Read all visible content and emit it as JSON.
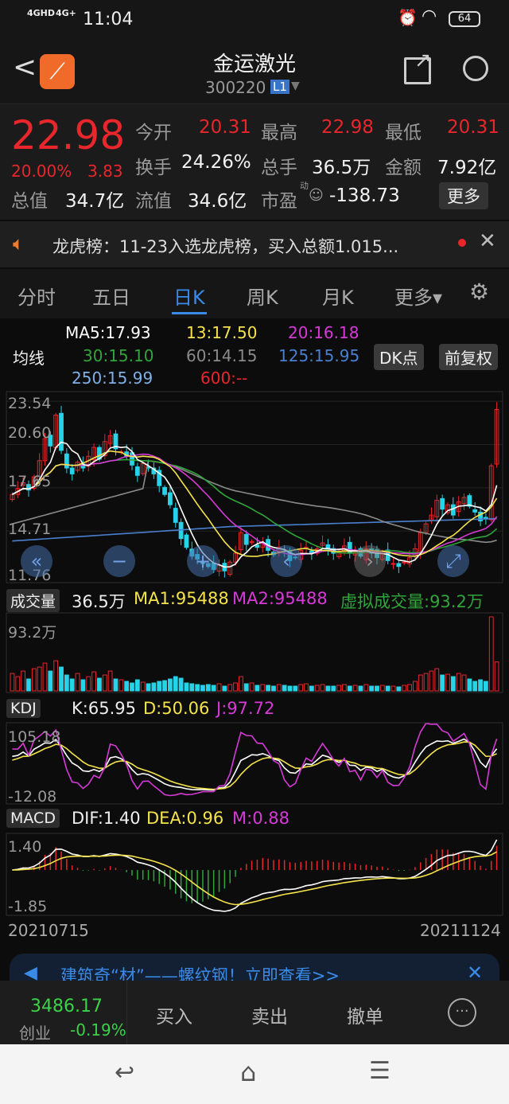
{
  "status": {
    "network1": "4GHD",
    "network2": "4G+",
    "time": "11:04",
    "battery": "64"
  },
  "header": {
    "title": "金运激光",
    "code": "300220",
    "level": "L1"
  },
  "quote": {
    "price": "22.98",
    "change_pct": "20.00%",
    "change": "3.83",
    "open_label": "今开",
    "open": "20.31",
    "high_label": "最高",
    "high": "22.98",
    "low_label": "最低",
    "low": "20.31",
    "turnover_label": "换手",
    "turnover": "24.26%",
    "volume_label": "总手",
    "volume": "36.5万",
    "amount_label": "金额",
    "amount": "7.92亿",
    "mcap_label": "总值",
    "mcap": "34.7亿",
    "float_label": "流值",
    "float": "34.6亿",
    "pe_label": "市盈",
    "pe_sup": "动",
    "pe": "-138.73",
    "more": "更多"
  },
  "notice": {
    "text": "龙虎榜：11-23入选龙虎榜，买入总额1.015..."
  },
  "tabs": [
    {
      "label": "分时"
    },
    {
      "label": "五日"
    },
    {
      "label": "日K"
    },
    {
      "label": "周K"
    },
    {
      "label": "月K"
    },
    {
      "label": "更多▾"
    }
  ],
  "ma_legend": {
    "title": "均线",
    "ma5": "MA5:17.93",
    "ma13": "13:17.50",
    "ma20": "20:16.18",
    "ma30": "30:15.10",
    "ma60": "60:14.15",
    "ma125": "125:15.95",
    "ma250": "250:15.99",
    "ma600": "600:--",
    "dk": "DK点",
    "fq": "前复权"
  },
  "colors": {
    "up": "#e8262b",
    "down": "#27d3e6",
    "ma5": "#ffffff",
    "ma13": "#f4e34a",
    "ma20": "#d63ad6",
    "ma30": "#2fa53a",
    "ma60": "#8a8a8a",
    "ma125": "#4a7fd0",
    "ma250": "#7fb0e6"
  },
  "chart_data": {
    "type": "candlestick",
    "y_ticks": [
      "23.54",
      "20.60",
      "17.65",
      "14.71",
      "11.76"
    ],
    "ylim": [
      11.2,
      24.2
    ],
    "closes": [
      17.2,
      17.6,
      18.0,
      17.5,
      18.4,
      19.5,
      21.0,
      20.5,
      22.6,
      20.2,
      19.0,
      18.6,
      19.4,
      19.0,
      19.8,
      20.4,
      19.6,
      20.8,
      21.2,
      20.3,
      20.1,
      19.8,
      19.2,
      18.5,
      19.3,
      19.0,
      18.6,
      17.8,
      17.2,
      16.5,
      15.3,
      14.2,
      13.6,
      13.0,
      12.8,
      12.5,
      12.3,
      12.1,
      12.4,
      12.0,
      12.6,
      13.2,
      14.6,
      13.8,
      14.0,
      13.6,
      13.9,
      13.4,
      13.1,
      13.6,
      13.3,
      12.7,
      12.9,
      13.4,
      13.6,
      13.2,
      13.5,
      13.9,
      13.4,
      13.2,
      13.3,
      13.7,
      13.2,
      13.4,
      13.0,
      13.5,
      13.2,
      12.9,
      13.3,
      12.7,
      12.5,
      12.3,
      12.6,
      12.9,
      13.5,
      14.6,
      15.2,
      15.8,
      16.8,
      16.2,
      16.5,
      15.8,
      16.7,
      17.0,
      16.4,
      16.0,
      15.4,
      15.6,
      19.15,
      22.98
    ],
    "volumes": [
      22,
      18,
      25,
      15,
      28,
      30,
      35,
      25,
      38,
      30,
      20,
      15,
      22,
      14,
      18,
      24,
      16,
      20,
      25,
      15,
      14,
      12,
      10,
      14,
      11,
      9,
      10,
      12,
      13,
      15,
      18,
      16,
      10,
      9,
      8,
      7,
      8,
      7,
      9,
      6,
      8,
      10,
      18,
      9,
      10,
      7,
      8,
      7,
      6,
      8,
      7,
      6,
      6,
      8,
      9,
      6,
      7,
      8,
      6,
      6,
      7,
      8,
      6,
      7,
      6,
      8,
      6,
      6,
      7,
      6,
      6,
      5,
      7,
      8,
      12,
      20,
      22,
      25,
      28,
      20,
      21,
      18,
      22,
      20,
      15,
      12,
      14,
      12,
      93.2,
      36.5
    ],
    "volume": {
      "label": "成交量",
      "value": "36.5万",
      "ma1": "MA1:95488",
      "ma2": "MA2:95488",
      "virtual": "虚拟成交量:93.2万",
      "max": "93.2万"
    },
    "kdj": {
      "label": "KDJ",
      "k": "K:65.95",
      "d": "D:50.06",
      "j": "J:97.72",
      "max": "105.18",
      "min": "-12.08"
    },
    "macd": {
      "label": "MACD",
      "dif": "DIF:1.40",
      "dea": "DEA:0.96",
      "m": "M:0.88",
      "max": "1.40",
      "min": "-1.85"
    },
    "start_date": "20210715",
    "end_date": "20211124"
  },
  "ad": {
    "text": "建筑奇“材”——螺纹钢！立即查看>>"
  },
  "bottom": {
    "index_value": "3486.17",
    "index_name": "创业",
    "index_change": "-0.19%",
    "buy": "买入",
    "sell": "卖出",
    "cancel": "撤单"
  }
}
